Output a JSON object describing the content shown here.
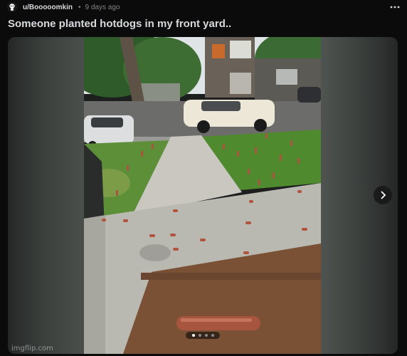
{
  "post": {
    "author": "u/Booooomkin",
    "separator": "•",
    "time": "9 days ago",
    "more_icon": "more-horizontal-icon",
    "title": "Someone planted hotdogs in my front yard.."
  },
  "gallery": {
    "current_index": 1,
    "total": 4,
    "next_icon": "chevron-right-icon"
  },
  "watermark": "imgflip.com",
  "colors": {
    "background": "#0b0b0c",
    "text": "#d7dadc",
    "muted": "#818384",
    "lawn": "#4f8a2f",
    "concrete": "#b9b8b1",
    "hotdog": "#a8553f"
  }
}
